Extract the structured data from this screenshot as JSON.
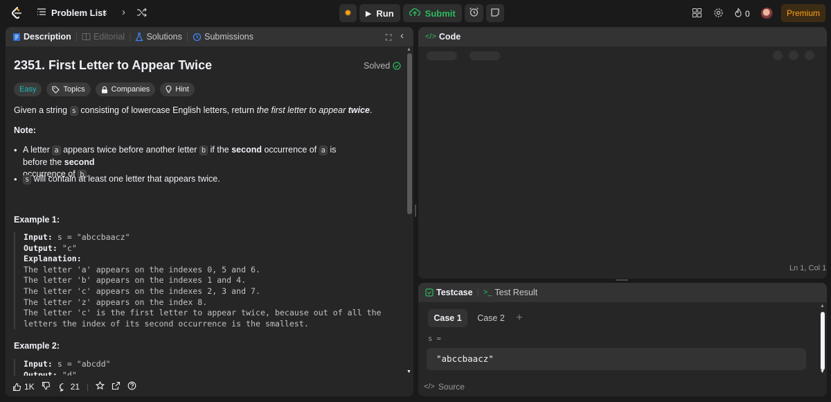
{
  "topbar": {
    "problem_list": "Problem List",
    "run": "Run",
    "submit": "Submit",
    "streak": "0",
    "premium": "Premium",
    "accent": "#ffa116",
    "submit_color": "#2cbb5d"
  },
  "left": {
    "tabs": [
      "Description",
      "Editorial",
      "Solutions",
      "Submissions"
    ],
    "title": "2351. First Letter to Appear Twice",
    "solved": "Solved",
    "chips": [
      "Easy",
      "Topics",
      "Companies",
      "Hint"
    ],
    "desc": {
      "a": "Given a string ",
      "s": "s",
      "b": " consisting of lowercase English letters, return ",
      "c": "the first letter to appear ",
      "d": "twice",
      "e": "."
    },
    "note": "Note:",
    "bullet1": {
      "a": "A letter ",
      "va": "a",
      "b": " appears twice before another letter ",
      "vb": "b",
      "c": " if the ",
      "second1": "second",
      "d": " occurrence of ",
      "va2": "a",
      "e": " is before the ",
      "second2": "second",
      "f": "occurrence of ",
      "vb2": "b",
      "g": "."
    },
    "bullet2": {
      "s": "s",
      "text": " will contain at least one letter that appears twice."
    },
    "example1_title": "Example 1:",
    "example1": {
      "input_k": "Input:",
      "input_v": " s = \"abccbaacz\"",
      "output_k": "Output:",
      "output_v": " \"c\"",
      "expl_k": "Explanation:",
      "lines": [
        "The letter 'a' appears on the indexes 0, 5 and 6.",
        "The letter 'b' appears on the indexes 1 and 4.",
        "The letter 'c' appears on the indexes 2, 3 and 7.",
        "The letter 'z' appears on the index 8.",
        "The letter 'c' is the first letter to appear twice, because out of all the",
        "letters the index of its second occurrence is the smallest."
      ]
    },
    "example2_title": "Example 2:",
    "example2": {
      "input_k": "Input:",
      "input_v": " s = \"abcdd\"",
      "output_k": "Output:",
      "output_v": " \"d\""
    },
    "footer": {
      "likes": "1K",
      "comments": "21"
    }
  },
  "code": {
    "title": "Code",
    "status": "Ln 1, Col 1"
  },
  "test": {
    "tabs": [
      "Testcase",
      "Test Result"
    ],
    "cases": [
      "Case 1",
      "Case 2"
    ],
    "var_label": "s =",
    "var_value": "\"abccbaacz\"",
    "source": "Source"
  }
}
